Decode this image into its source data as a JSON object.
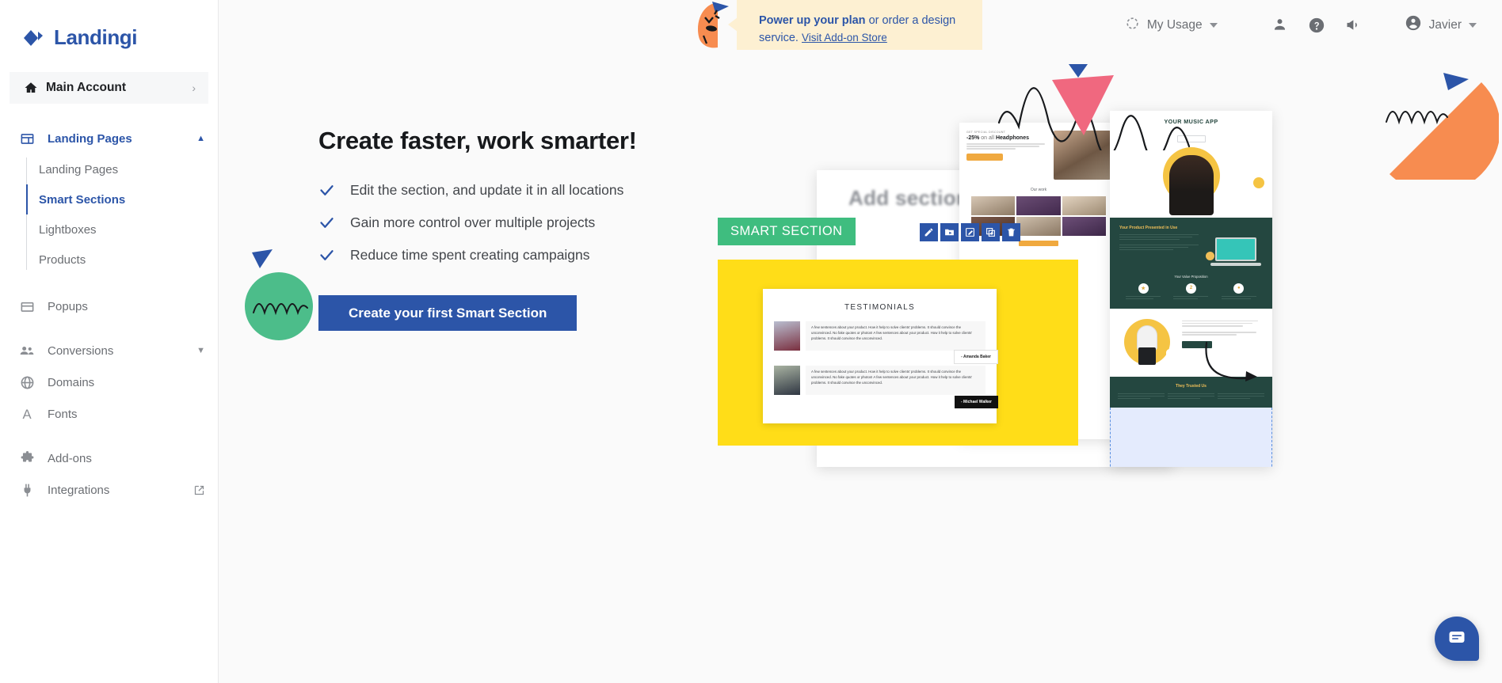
{
  "brand": {
    "name": "Landingi",
    "logo_icon": "landingi-diamond-logo"
  },
  "colors": {
    "brand_blue": "#2c55a8",
    "banner_bg": "#fdf0d2",
    "badge_green": "#3fbd7f",
    "panel_yellow": "#ffdd18",
    "mascot_orange": "#f78c50",
    "accent_pink": "#f0687f"
  },
  "sidebar": {
    "account": {
      "label": "Main Account",
      "icon": "home-icon",
      "chevron": "chevron-right-icon"
    },
    "items": [
      {
        "label": "Landing Pages",
        "icon": "layout-icon",
        "expanded": true,
        "caret": "chevron-up-icon",
        "active": true,
        "children": [
          {
            "label": "Landing Pages",
            "active": false
          },
          {
            "label": "Smart Sections",
            "active": true
          },
          {
            "label": "Lightboxes",
            "active": false
          },
          {
            "label": "Products",
            "active": false
          }
        ]
      },
      {
        "label": "Popups",
        "icon": "popup-window-icon"
      },
      {
        "label": "Conversions",
        "icon": "people-icon",
        "caret": "chevron-down-icon"
      },
      {
        "label": "Domains",
        "icon": "globe-icon"
      },
      {
        "label": "Fonts",
        "icon": "font-letter-a-icon"
      },
      {
        "label": "Add-ons",
        "icon": "puzzle-piece-icon"
      },
      {
        "label": "Integrations",
        "icon": "plug-icon",
        "external": "external-link-icon"
      }
    ]
  },
  "header": {
    "usage": {
      "label": "My Usage",
      "icon": "gauge-icon",
      "caret": "caret-down-icon"
    },
    "icons": [
      {
        "name": "contact-person-icon"
      },
      {
        "name": "help-circle-icon"
      },
      {
        "name": "megaphone-icon"
      }
    ],
    "user": {
      "name": "Javier",
      "icon": "account-circle-icon",
      "caret": "caret-down-icon"
    }
  },
  "promo_banner": {
    "bold_text": "Power up your plan",
    "rest_text": " or order a design service. ",
    "link_text": "Visit Add-on Store",
    "mascot_icon": "orange-mascot-icon"
  },
  "hero": {
    "title": "Create faster, work smarter!",
    "features": [
      {
        "icon": "check-icon",
        "text": "Edit the section, and update it in all locations"
      },
      {
        "icon": "check-icon",
        "text": "Gain more control over multiple projects"
      },
      {
        "icon": "check-icon",
        "text": "Reduce time spent creating campaigns"
      }
    ],
    "cta_label": "Create your first Smart Section"
  },
  "illustration": {
    "add_section_text": "Add section",
    "smart_section_badge": "SMART SECTION",
    "toolbar_icons": [
      {
        "name": "pencil-edit-icon"
      },
      {
        "name": "image-folder-icon"
      },
      {
        "name": "edit-box-icon"
      },
      {
        "name": "duplicate-add-icon"
      },
      {
        "name": "trash-delete-icon"
      }
    ],
    "testimonials": {
      "heading": "TESTIMONIALS",
      "items": [
        {
          "quote": "A few sentences about your product. How it help to solve clients' problems. It should convince the unconvinced. No fake quotes or photos! A few sentences about your product. How it help to solve clients' problems. It should convince the unconvinced.",
          "author": "- Amanda Baker"
        },
        {
          "quote": "A few sentences about your product. How it help to solve clients' problems. It should convince the unconvinced. No fake quotes or photos! A few sentences about your product. How it help to solve clients' problems. It should convince the unconvinced.",
          "author": "- Michael Walker"
        }
      ]
    },
    "mid_page": {
      "kicker": "GET SPECIAL DISCOUNT",
      "headline_discount": "-25%",
      "headline_rest": " on all ",
      "headline_bold": "Headphones",
      "our_work": "Our work"
    },
    "right_page": {
      "title": "YOUR MUSIC APP",
      "section_dark_heading": "Your Product Presented in Use",
      "value_prop": "Your Value Proposition",
      "trusted": "They Trusted Us"
    }
  },
  "chat": {
    "icon": "chat-bubble-icon"
  }
}
